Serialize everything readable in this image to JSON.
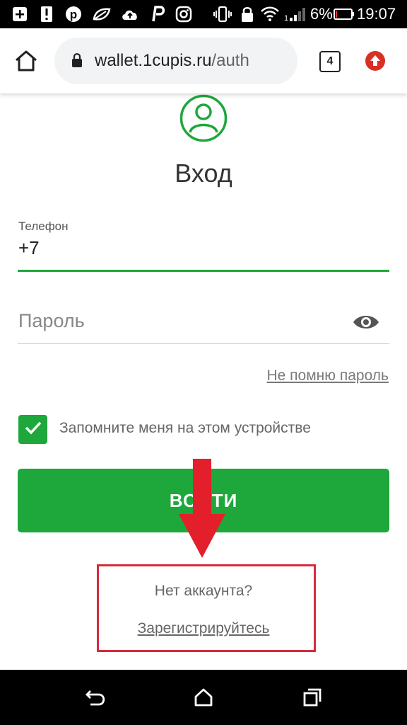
{
  "status_bar": {
    "battery_percent": "6%",
    "time": "19:07",
    "icons": [
      "add-box-icon",
      "alert-icon",
      "pinterest-icon",
      "leaf-icon",
      "cloud-upload-icon",
      "p-icon",
      "instagram-icon",
      "vibrate-icon",
      "lock-icon",
      "wifi-icon",
      "signal-icon",
      "battery-icon"
    ]
  },
  "browser": {
    "url_host": "wallet.1cupis.ru",
    "url_path": "/auth",
    "tabs_count": "4"
  },
  "page": {
    "title": "Вход",
    "phone_label": "Телефон",
    "phone_value": "+7",
    "password_placeholder": "Пароль",
    "forgot_password": "Не помню пароль",
    "remember_me": "Запомните меня на этом устройстве",
    "remember_checked": true,
    "login_button": "ВОЙТИ",
    "no_account": "Нет аккаунта?",
    "register_link": "Зарегистрируйтесь"
  },
  "colors": {
    "accent": "#1ea73b",
    "annotation": "#d62c3a"
  }
}
